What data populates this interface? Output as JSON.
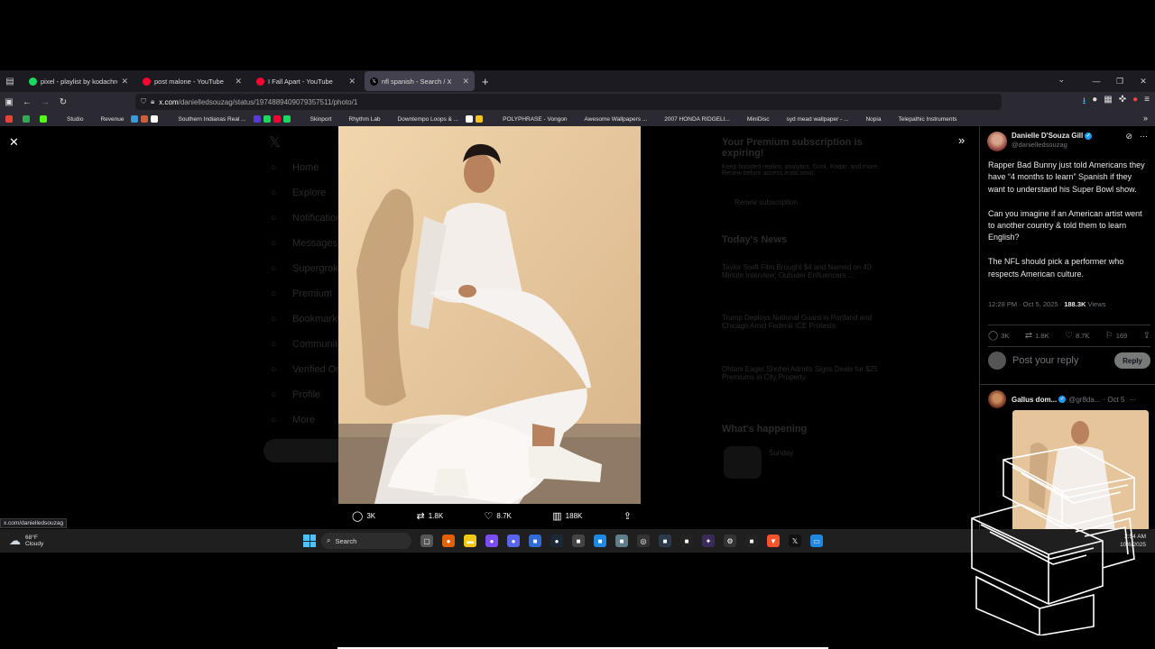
{
  "browser": {
    "tabs": [
      {
        "title": "pixel - playlist by kodachromefl",
        "icon_color": "#1ed760",
        "active": false
      },
      {
        "title": "post malone - YouTube",
        "icon_color": "#ff0033",
        "active": false
      },
      {
        "title": "I Fall Apart - YouTube",
        "icon_color": "#ff0033",
        "active": false
      },
      {
        "title": "nfl spanish - Search / X",
        "icon_color": "#000000",
        "active": true
      }
    ],
    "url_host": "x.com",
    "url_path": "/danielledsouzag/status/1974889409079357511/photo/1",
    "bookmarks": [
      {
        "label": "Studio",
        "color": "#ff0033"
      },
      {
        "label": "Revenue",
        "color": "#4a2bd6"
      },
      {
        "label": "Southern Indianas Real ...",
        "color": "#dddddd"
      },
      {
        "label": "Skinport",
        "color": "#444444"
      },
      {
        "label": "Rhythm Lab",
        "color": "#333333"
      },
      {
        "label": "Downtempo Loops & ...",
        "color": "#666666"
      },
      {
        "label": "POLYPHRASE - Vongon",
        "color": "#dddddd"
      },
      {
        "label": "Awesome Wallpapers ...",
        "color": "#888888"
      },
      {
        "label": "2007 HONDA RIDGELI...",
        "color": "#3344aa"
      },
      {
        "label": "MiniDisc",
        "color": "#888888"
      },
      {
        "label": "syd mead wallpaper - ...",
        "color": "#4285f4"
      },
      {
        "label": "Nopia",
        "color": "#cc33aa"
      },
      {
        "label": "Telepathic Instruments",
        "color": "#222222"
      }
    ],
    "status_url": "x.com/danielledsouzag"
  },
  "photo_actions": {
    "replies": "3K",
    "reposts": "1.8K",
    "likes": "8.7K",
    "views": "188K"
  },
  "tweet": {
    "author_name": "Danielle D'Souza Gill",
    "author_handle": "@danielledsouzag",
    "paragraphs": [
      "Rapper Bad Bunny just told Americans they have “4 months to learn” Spanish if they want to understand his Super Bowl show.",
      "Can you imagine if an American artist went to another country & told them to learn English?",
      "The NFL should pick a performer who respects American culture."
    ],
    "timestamp": "12:28 PM · Oct 5, 2025 · ",
    "views_count": "188.3K",
    "views_label": " Views",
    "stats": {
      "replies": "3K",
      "reposts": "1.8K",
      "likes": "8.7K",
      "bookmarks": "169"
    },
    "reply_placeholder": "Post your reply",
    "reply_button": "Reply"
  },
  "reply_tweet": {
    "name": "Gallus dom...",
    "handle": "@gr8da...",
    "date": "· Oct 5"
  },
  "background_sidebar": [
    "Home",
    "Explore",
    "Notifications",
    "Messages",
    "Supergrok",
    "Premium",
    "Bookmarks",
    "Communities",
    "Verified Orgs",
    "Profile",
    "More"
  ],
  "background_right": {
    "premium_title": "Your Premium subscription is expiring!",
    "premium_body": "Keep boosted replies, analytics, Grok, Radar, and more. Renew before access ends soon.",
    "premium_button": "Renew subscription",
    "news_title": "Today's News",
    "news_items": [
      "Taylor Swift Film Brought $4 and Named on 40 Minute Interview; Outsider Enfluencers ...",
      "Trump Deploys National Guard in Portland and Chicago Amid Federal ICE Protests",
      "Ohtani Eager Shohei Admits Signs Deals for $25 Premiums in City Property"
    ],
    "happening_title": "What's happening",
    "happening_item": "Sunday"
  },
  "taskbar": {
    "temp": "68°F",
    "condition": "Cloudy",
    "search_label": "Search",
    "time": "2:54 AM",
    "date": "10/6/2025"
  }
}
